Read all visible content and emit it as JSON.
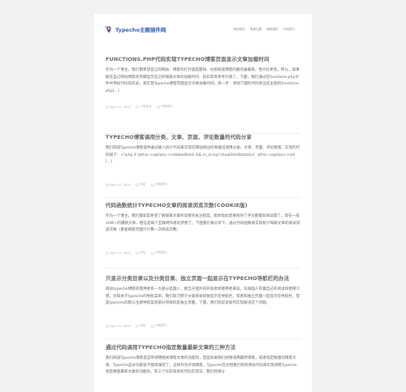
{
  "site": {
    "logo_text": "Typecho主题插件网",
    "nav": [
      "网站首页",
      "免费主题",
      "更新插件",
      "代码技巧"
    ]
  },
  "posts": [
    {
      "title": "FUNCTIONS.PHP代码实现TYPECHO博客页面显示文章加载时间",
      "excerpt": "作为一个博主，我们都希望自己的网站、博客的打开速度最快、也想知道博客的服务器最快，性价比更高。所以，如果能在自己网站博客的页脚显示自己的每篇文章的加载时间，就非常有参考价值了。下面，我们通过在functions.php文件中添加代码的形式，来实现Typecho博客页面显示文章加载时间。第一步：添加下面的代码到当前主题的functions.php[...]",
      "date": "April 12, 2020",
      "comments": "1 条评论",
      "category": "代码技巧"
    },
    {
      "title": "TYPECHO博客调用分类、文章、页面、评论数量的代码分享",
      "excerpt": "我们知道Typecho博客提供通过输入统计代码来实现在网站侧边栏来输出调用分类、文章、页面、评论数量。实现的代码如下：<?php if ($this->options->sidebarBlock && in_array('showSiteStatistics', $this->options->sid[...]",
      "date": "April 12, 2020",
      "comments": "评论",
      "category": "代码技巧"
    },
    {
      "title": "代码函数统计TYPECHO文章的阅读浏览次数(COOKIE版)",
      "excerpt": "作为一个博主，我们都非常希望了解每篇文章的读者的关注程度，能体现此结果的除了评论数量就阅读量了，现在一般10W+的爆款文章，相信是每个互联网作者的梦想了。下面我们来分享下，通过代码函数来实现统计每篇文章的阅读浏览次数（重复刷新页面只计算一次阅读次数）",
      "date": "April 12, 2020",
      "comments": "评论",
      "category": "代码技巧"
    },
    {
      "title": "只显示分类目录以及分类目录、独立页面一起显示在TYPECHO导航栏的办法",
      "excerpt": "目前typecho博客的使用者有一大部分是国人，相当于国外的开发者和使用者来说，毕竟国人有着自己的阅读和使用习惯。比如关于typecho的导航菜单，我们就习惯于分类目录单独显示在导航栏，或者和独立页面一起显示在导航栏，但是typecho的默认主题导航菜单部分同样的是独立页面，下面，我们就说说如何实现解决这个问题。",
      "date": "April 12, 2020",
      "comments": "评论",
      "category": "代码技巧"
    },
    {
      "title": "通过代码调用TYPECHO指定数量最新文章的三种方法",
      "excerpt": "我们知道Typecho博客是自带调用相关博客文章的功能的，但是如果我们想要调用最新博客，或者指定数量的博客文章，Typecho自身功能就不能够满足了，这样作为开源博客，Typecho在文档我们修改添加代码来实现调用Typecho指定数量最新文章的功能的，有三个比较简单的代码实现法，我们简单分",
      "date": "April 12, 2020",
      "comments": "评论",
      "category": "代码技巧"
    }
  ],
  "colors": {
    "background": "#f2f2f2",
    "card": "#ffffff",
    "logo_blue": "#2f63b4",
    "logo_red": "#d9332b"
  },
  "icons": {
    "meta_date": "clock-icon",
    "meta_comments": "comment-icon",
    "meta_category": "folder-icon"
  }
}
